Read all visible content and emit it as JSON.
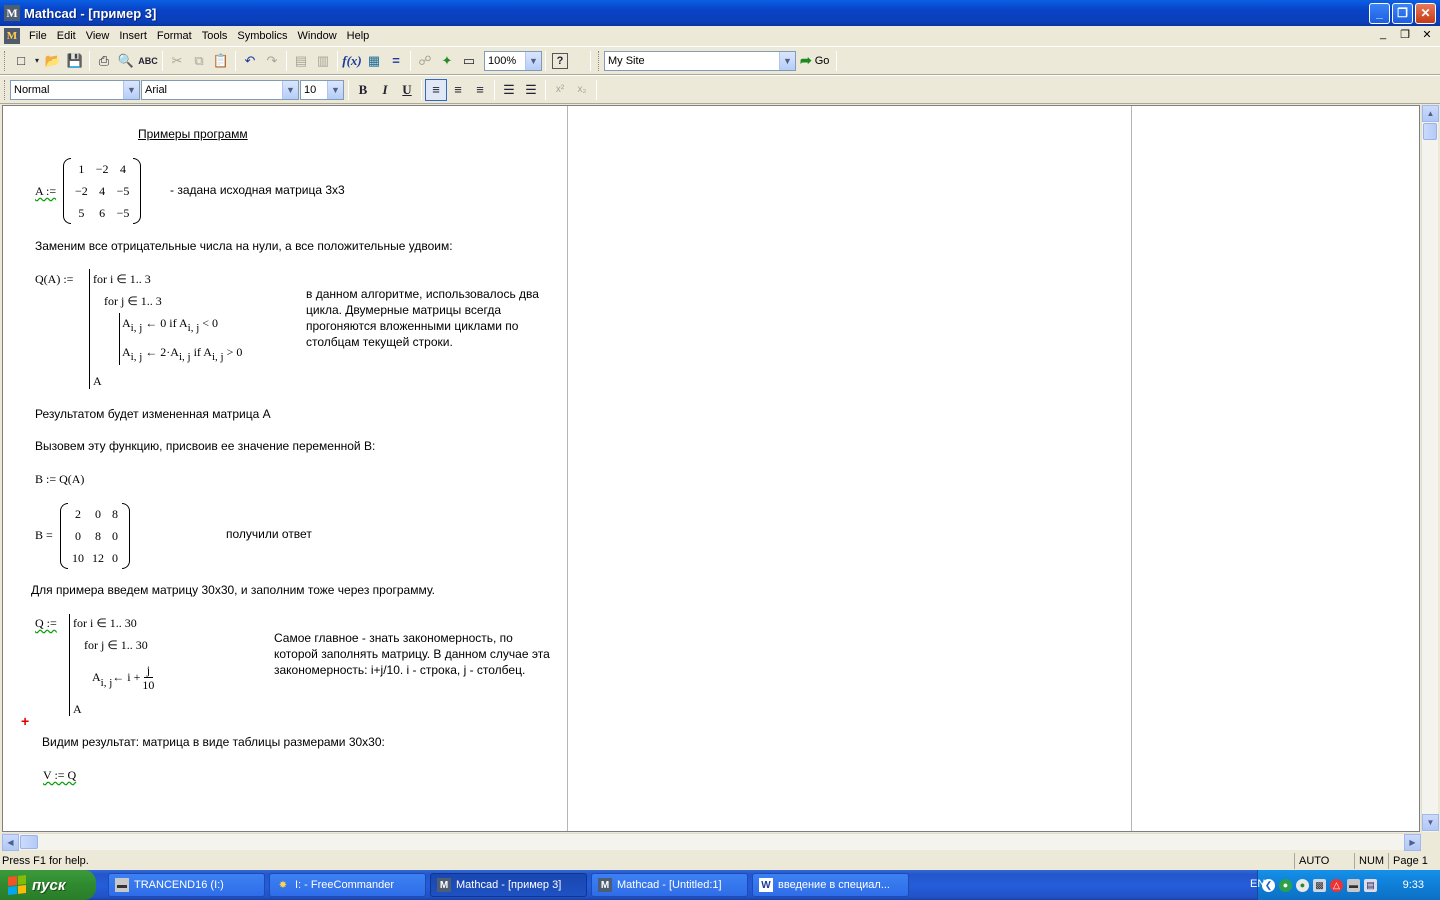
{
  "window": {
    "title": "Mathcad - [пример 3]",
    "app_icon": "M",
    "controls": {
      "minimize": "_",
      "maximize": "❐",
      "close": "✕"
    }
  },
  "menu": {
    "items": [
      "File",
      "Edit",
      "View",
      "Insert",
      "Format",
      "Tools",
      "Symbolics",
      "Window",
      "Help"
    ],
    "doc_controls": [
      "_",
      "❐",
      "✕"
    ]
  },
  "toolbar": {
    "zoom": "100%",
    "site": "My Site",
    "go_label": "Go",
    "style": "Normal",
    "font": "Arial",
    "size": "10",
    "bold": "B",
    "italic": "I",
    "underline": "U"
  },
  "worksheet": {
    "heading": "Примеры программ",
    "matrix_a_label": "A :=",
    "matrix_a": [
      [
        "1",
        "−2",
        "4"
      ],
      [
        "−2",
        "4",
        "−5"
      ],
      [
        "5",
        "6",
        "−5"
      ]
    ],
    "matrix_a_note": "- задана исходная матрица 3х3",
    "replace_text": "Заменим все отрицательные числа на нули, а все положительные удвоим:",
    "prog_q_label": "Q(A) :=",
    "prog_q_lines": {
      "for_i": "for  i ∈ 1.. 3",
      "for_j": "for  j ∈ 1.. 3",
      "line1_a": "A",
      "line1_sub": "i, j",
      "line1_b": " ← 0  if  A",
      "line1_sub2": "i, j",
      "line1_c": " < 0",
      "line2_a": "A",
      "line2_sub": "i, j",
      "line2_b": " ← 2·A",
      "line2_sub2": "i, j",
      "line2_c": "  if  A",
      "line2_sub3": "i, j",
      "line2_d": " > 0",
      "ret": "A"
    },
    "prog_q_comment": "в данном алгоритме, использовалось два цикла. Двумерные матрицы всегда прогоняются вложенными циклами по столбцам текущей строки.",
    "result_text": "Результатом будет измененная матрица А",
    "call_text": "Вызовем эту функцию, присвоив ее значение переменной B:",
    "b_assign": "B := Q(A)",
    "matrix_b_label": "B =",
    "matrix_b": [
      [
        "2",
        "0",
        "8"
      ],
      [
        "0",
        "8",
        "0"
      ],
      [
        "10",
        "12",
        "0"
      ]
    ],
    "matrix_b_note": "получили ответ",
    "example_text": "Для примера введем матрицу 30х30, и заполним тоже через программу.",
    "prog_q2_label": "Q :=",
    "prog_q2_lines": {
      "for_i": "for  i ∈ 1.. 30",
      "for_j": "for  j ∈ 1.. 30",
      "assign_a": "A",
      "assign_sub": "i, j",
      "assign_b": " ← i + ",
      "frac_num": "j",
      "frac_den": "10",
      "ret": "A"
    },
    "prog_q2_comment": "Самое главное - знать закономерность, по которой заполнять матрицу. В данном случае эта закономерность: i+j/10. i - строка, j - столбец.",
    "view_text": "Видим результат: матрица в виде таблицы размерами 30х30:",
    "v_assign": "V := Q",
    "crosshair": "+"
  },
  "status": {
    "help": "Press F1 for help.",
    "auto": "AUTO",
    "num": "NUM",
    "page": "Page 1"
  },
  "taskbar": {
    "start": "пуск",
    "tasks": [
      "TRANCEND16 (I:)",
      "I: - FreeCommander",
      "Mathcad - [пример 3]",
      "Mathcad - [Untitled:1]",
      "введение в специал..."
    ],
    "lang": "EN",
    "clock": "9:33"
  }
}
